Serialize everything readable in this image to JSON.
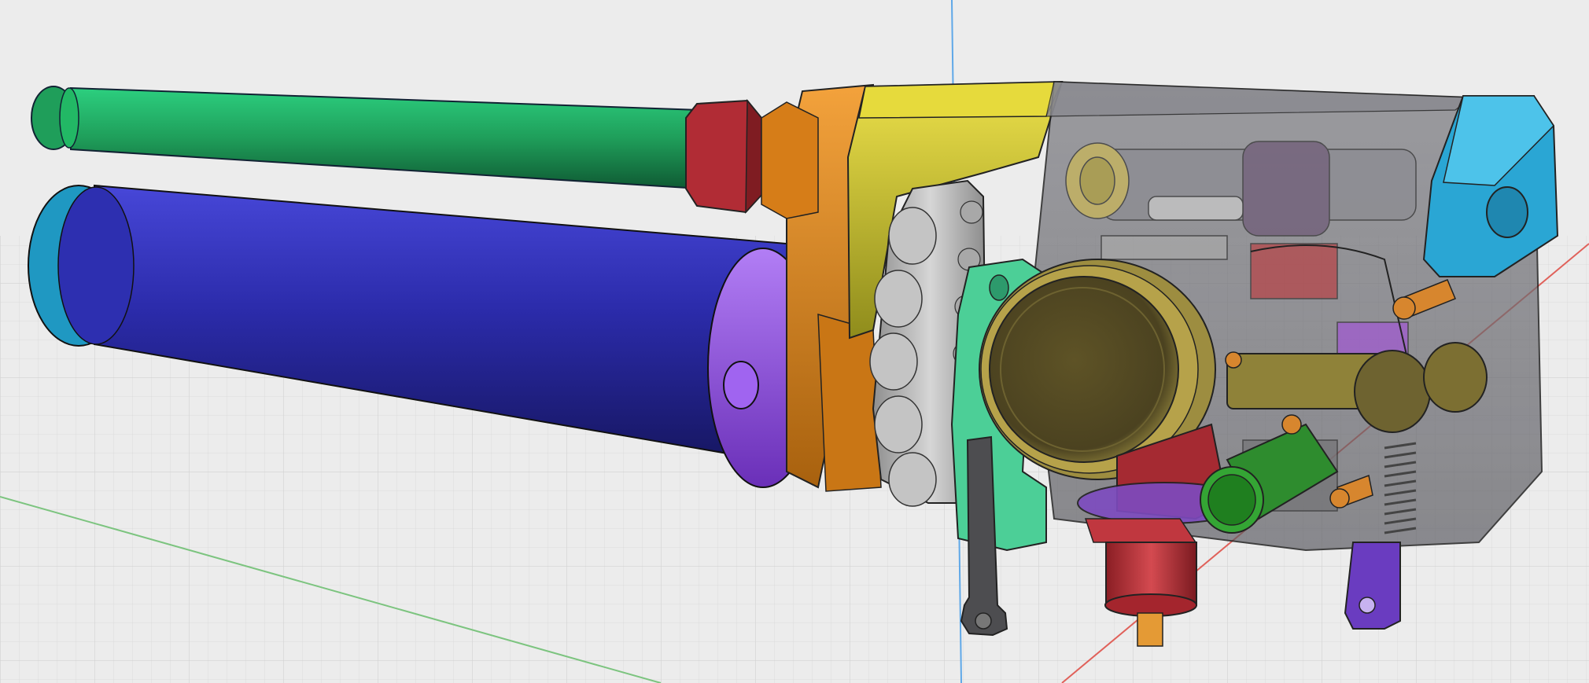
{
  "viewport": {
    "background": "#ececec",
    "grid_color": "#d9d9d9",
    "axes": {
      "x_color": "#e0615a",
      "y_color": "#7cc47f",
      "z_color": "#5fa8e8"
    }
  },
  "model": {
    "parts": [
      {
        "id": "green-tube",
        "color": "#22a862"
      },
      {
        "id": "red-nut",
        "color": "#b8303a"
      },
      {
        "id": "blue-tank",
        "color": "#2d2fb0"
      },
      {
        "id": "cyan-endcap",
        "color": "#2ab2d6"
      },
      {
        "id": "purple-collar",
        "color": "#9a55e0"
      },
      {
        "id": "orange-block",
        "color": "#e08a1c"
      },
      {
        "id": "yellow-block",
        "color": "#d7d43a"
      },
      {
        "id": "gray-wheel",
        "color": "#b4b4b4"
      },
      {
        "id": "olive-knob",
        "color": "#7c6f32"
      },
      {
        "id": "mint-plate",
        "color": "#4fd09a"
      },
      {
        "id": "dark-lever",
        "color": "#555555"
      },
      {
        "id": "smoke-housing",
        "color": "#6b6b70"
      },
      {
        "id": "cyan-corner",
        "color": "#34b3e0"
      },
      {
        "id": "red-valve",
        "color": "#c4363e"
      },
      {
        "id": "green-button",
        "color": "#2e8c2e"
      },
      {
        "id": "purple-tab",
        "color": "#6a3cc0"
      },
      {
        "id": "small-pins",
        "color": "#d7862e"
      },
      {
        "id": "spring",
        "color": "#555555"
      }
    ]
  }
}
